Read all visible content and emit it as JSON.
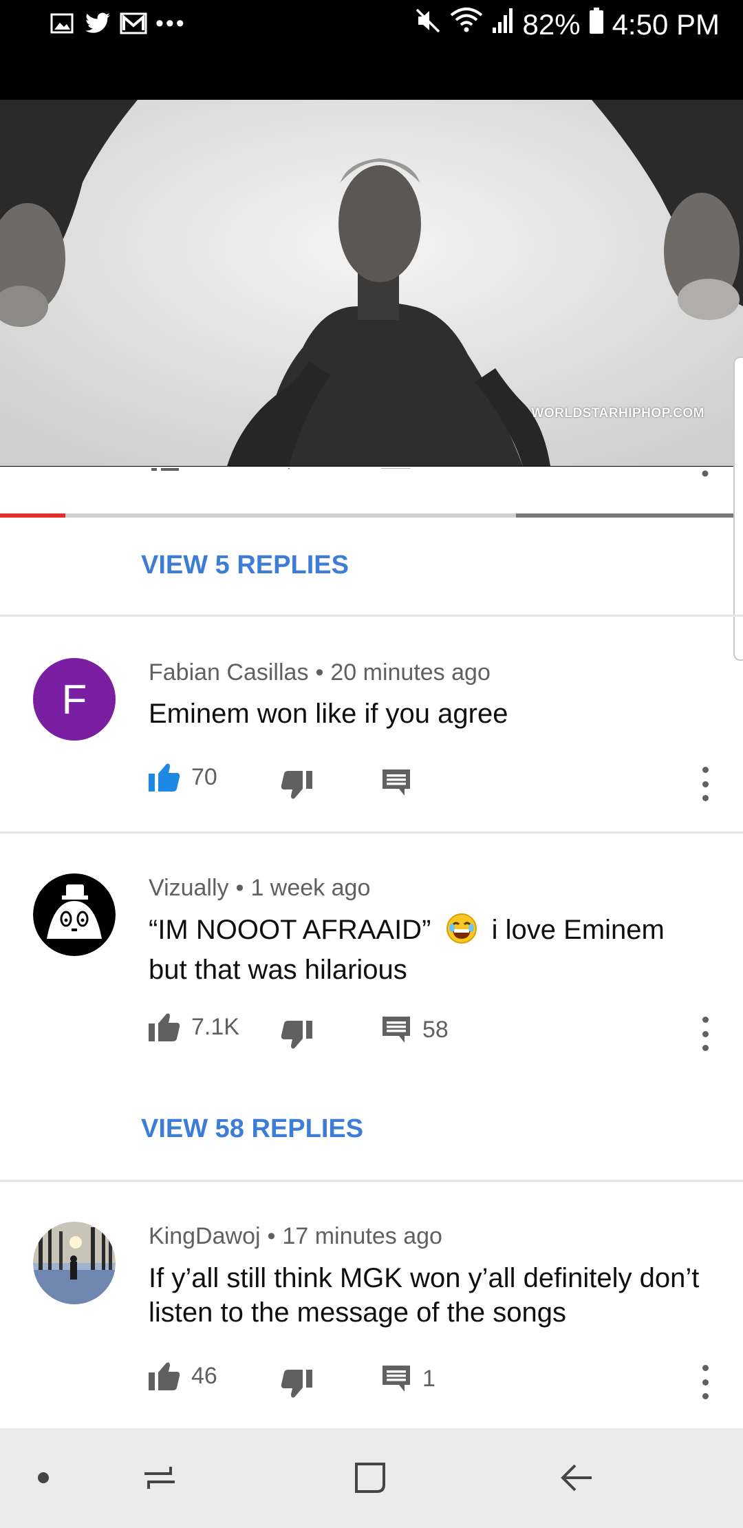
{
  "status_bar": {
    "notification_icons": [
      "gallery-icon",
      "twitter-icon",
      "gmail-icon"
    ],
    "overflow_dots": "•••",
    "battery_percent": "82%",
    "time": "4:50 PM"
  },
  "video": {
    "watermark": "WORLDSTARHIPHOP.COM",
    "progress_played_fraction": 0.09
  },
  "view_replies_top": "VIEW 5 REPLIES",
  "comments": [
    {
      "author": "Fabian Casillas",
      "separator": "•",
      "time": "20 minutes ago",
      "avatar_letter": "F",
      "avatar_color": "#7b1fa2",
      "text": "Eminem won like if you agree",
      "likes": "70",
      "liked": true,
      "replies_count": ""
    },
    {
      "author": "Vizually",
      "separator": "•",
      "time": "1 week ago",
      "text_line1_a": "“IM NOOOT AFRAAID”",
      "text_line1_b": "i love Eminem",
      "text_line2": "but that was hilarious",
      "emoji": "😂",
      "likes": "7.1K",
      "liked": false,
      "replies_count": "58",
      "view_replies": "VIEW 58 REPLIES"
    },
    {
      "author": "KingDawoj",
      "separator": "•",
      "time": "17 minutes ago",
      "text": "If y’all still think MGK won y’all definitely don’t listen to the message of the songs",
      "likes": "46",
      "liked": false,
      "replies_count": "1"
    }
  ],
  "colors": {
    "accent_blue": "#3e7dd6",
    "like_active": "#1e88e5",
    "icon_grey": "#606060",
    "progress_red": "#e52d27"
  },
  "nav_bar": {
    "icons": [
      "dot-icon",
      "recent-apps-icon",
      "home-icon",
      "back-icon"
    ]
  }
}
